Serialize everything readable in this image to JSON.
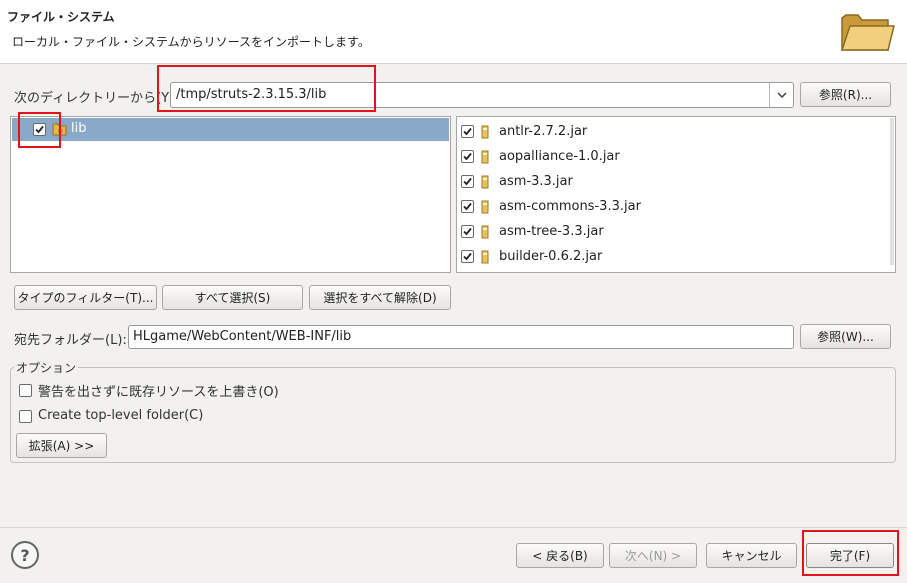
{
  "header": {
    "title": "ファイル・システム",
    "description": "ローカル・ファイル・システムからリソースをインポートします。"
  },
  "source": {
    "label": "次のディレクトリーから(Y):",
    "value": "/tmp/struts-2.3.15.3/lib",
    "browse_label": "参照(R)..."
  },
  "tree": {
    "items": [
      {
        "label": "lib",
        "checked": true
      }
    ]
  },
  "files": {
    "items": [
      {
        "name": "antlr-2.7.2.jar",
        "checked": true
      },
      {
        "name": "aopalliance-1.0.jar",
        "checked": true
      },
      {
        "name": "asm-3.3.jar",
        "checked": true
      },
      {
        "name": "asm-commons-3.3.jar",
        "checked": true
      },
      {
        "name": "asm-tree-3.3.jar",
        "checked": true
      },
      {
        "name": "builder-0.6.2.jar",
        "checked": true
      }
    ]
  },
  "actions": {
    "filter_label": "タイプのフィルター(T)...",
    "select_all_label": "すべて選択(S)",
    "deselect_all_label": "選択をすべて解除(D)"
  },
  "destination": {
    "label": "宛先フォルダー(L):",
    "value": "HLgame/WebContent/WEB-INF/lib",
    "browse_label": "参照(W)..."
  },
  "options": {
    "title": "オプション",
    "overwrite_label": "警告を出さずに既存リソースを上書き(O)",
    "overwrite_checked": false,
    "toplevel_label": "Create top-level folder(C)",
    "toplevel_checked": false,
    "advanced_label": "拡張(A) >>"
  },
  "footer": {
    "help_icon": "?",
    "back_label": "< 戻る(B)",
    "next_label": "次へ(N) >",
    "cancel_label": "キャンセル",
    "finish_label": "完了(F)"
  },
  "colors": {
    "selection": "#8aa8c8",
    "highlight_box": "#e0141a"
  }
}
